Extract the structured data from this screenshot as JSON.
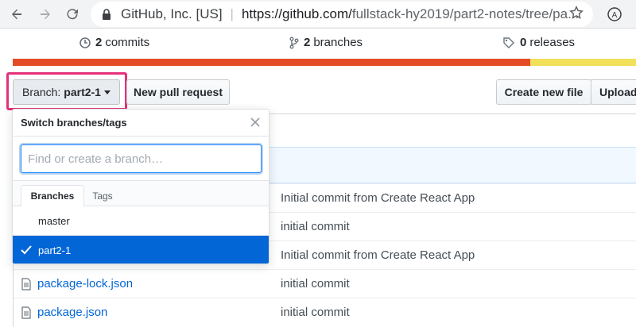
{
  "browser": {
    "org": "GitHub, Inc. [US]",
    "url_main": "https://github.com/",
    "url_rest": "fullstack-hy2019/part2-notes/tree/pa..."
  },
  "stats": {
    "commits": {
      "count": "2",
      "label": "commits"
    },
    "branches": {
      "count": "2",
      "label": "branches"
    },
    "releases": {
      "count": "0",
      "label": "releases"
    }
  },
  "language_bar": [
    {
      "color": "#e34c26",
      "fraction": 0.83
    },
    {
      "color": "#f1e05a",
      "fraction": 0.17
    }
  ],
  "toolbar": {
    "branch_prefix": "Branch:",
    "branch_name": "part2-1",
    "new_pr": "New pull request",
    "create_file": "Create new file",
    "upload": "Upload"
  },
  "dropdown": {
    "title": "Switch branches/tags",
    "placeholder": "Find or create a branch…",
    "tabs": {
      "branches": "Branches",
      "tags": "Tags"
    },
    "items": [
      {
        "label": "master",
        "selected": false
      },
      {
        "label": "part2-1",
        "selected": true
      }
    ]
  },
  "files": [
    {
      "name": "",
      "message": "Initial commit from Create React App"
    },
    {
      "name": "",
      "message": "initial commit"
    },
    {
      "name": "",
      "message": "Initial commit from Create React App"
    },
    {
      "name": "package-lock.json",
      "message": "initial commit"
    },
    {
      "name": "package.json",
      "message": "initial commit"
    }
  ],
  "colors": {
    "highlight": "#e5307a",
    "link": "#0366d6",
    "selected_bg": "#0366d6"
  }
}
